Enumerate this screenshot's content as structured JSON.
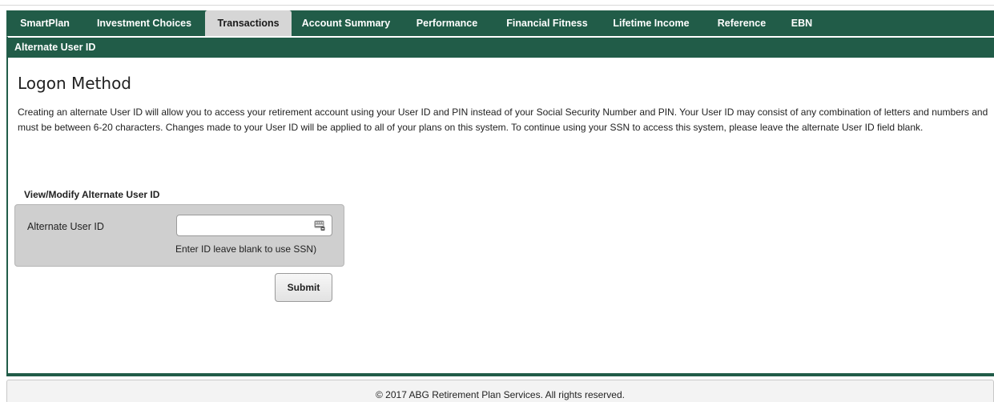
{
  "nav": {
    "tabs": [
      {
        "label": "SmartPlan"
      },
      {
        "label": "Investment Choices"
      },
      {
        "label": "Transactions",
        "active": true
      },
      {
        "label": "Account Summary"
      },
      {
        "label": "Performance"
      },
      {
        "label": "Financial Fitness"
      },
      {
        "label": "Lifetime Income"
      },
      {
        "label": "Reference"
      },
      {
        "label": "EBN"
      }
    ]
  },
  "panel": {
    "header": "Alternate User ID",
    "title": "Logon Method",
    "intro": "Creating an alternate User ID will allow you to access your retirement account using your User ID and PIN instead of your Social Security Number and PIN. Your User ID may consist of any combination of letters and numbers and must be between 6-20 characters. Changes made to your User ID will be applied to all of your plans on this system. To continue using your SSN to access this system, please leave the alternate User ID field blank."
  },
  "form": {
    "section_label": "View/Modify Alternate User ID",
    "field_label": "Alternate User ID",
    "field_value": "",
    "field_hint": "Enter ID leave blank to use SSN)",
    "submit_label": "Submit"
  },
  "footer": {
    "text": "© 2017 ABG Retirement Plan Services. All rights reserved."
  },
  "colors": {
    "brand_green": "#215c48",
    "active_tab": "#d6d6d6",
    "form_background": "#cfcfcf"
  },
  "icons": {
    "input_icon": "keyboard-icon"
  }
}
